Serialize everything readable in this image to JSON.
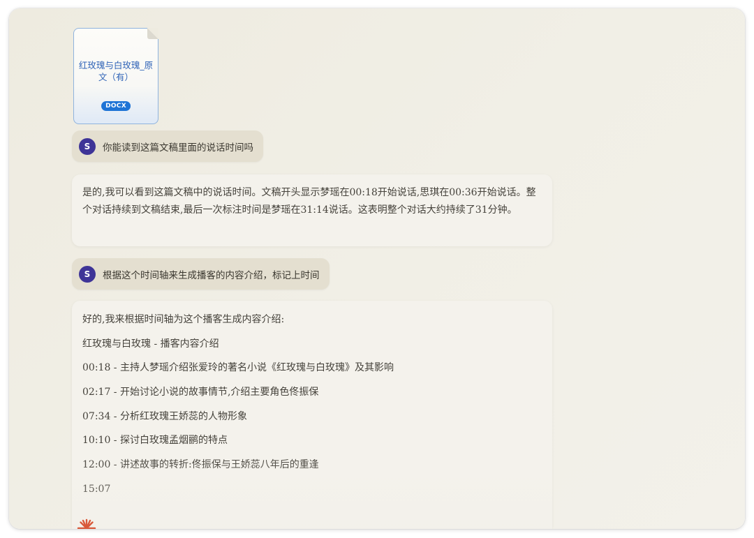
{
  "attachment": {
    "file_name": "红玫瑰与白玫瑰_原文（有）",
    "file_type": "DOCX"
  },
  "conversation": [
    {
      "role": "user",
      "avatar_letter": "S",
      "text": "你能读到这篇文稿里面的说话时间吗"
    },
    {
      "role": "assistant",
      "text": "是的,我可以看到这篇文稿中的说话时间。文稿开头显示梦瑶在00:18开始说话,思琪在00:36开始说话。整个对话持续到文稿结束,最后一次标注时间是梦瑶在31:14说话。这表明整个对话大约持续了31分钟。"
    },
    {
      "role": "user",
      "avatar_letter": "S",
      "text": "根据这个时间轴来生成播客的内容介绍，标记上时间"
    },
    {
      "role": "assistant",
      "lines": [
        "好的,我来根据时间轴为这个播客生成内容介绍:",
        "红玫瑰与白玫瑰 - 播客内容介绍",
        "00:18 - 主持人梦瑶介绍张爱玲的著名小说《红玫瑰与白玫瑰》及其影响",
        "02:17 - 开始讨论小说的故事情节,介绍主要角色佟振保",
        "07:34 - 分析红玫瑰王娇蕊的人物形象",
        "10:10 - 探讨白玫瑰孟烟鹂的特点",
        "12:00 - 讲述故事的转折:佟振保与王娇蕊八年后的重逢",
        "15:07"
      ]
    }
  ],
  "colors": {
    "avatar": "#3e3497",
    "user_bubble": "#e4dfd0",
    "assistant_bubble": "#f4f2ec",
    "file_badge": "#1f74d6",
    "spark": "#d9593a"
  },
  "icons": {
    "assistant_logo": "sparkle-icon"
  }
}
